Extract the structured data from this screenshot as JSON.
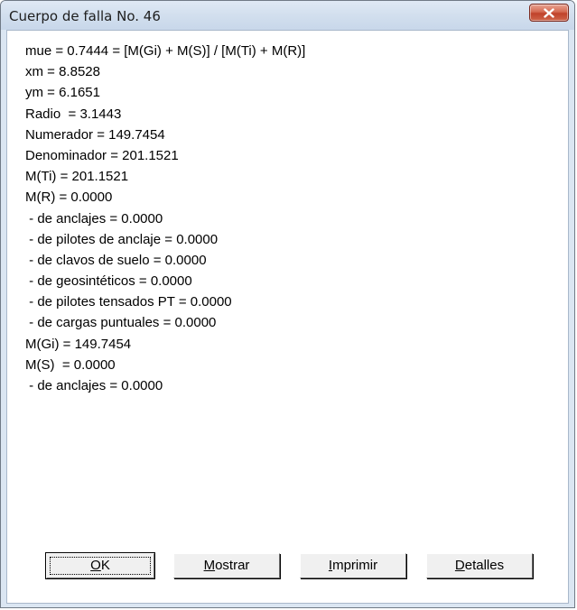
{
  "window": {
    "title": "Cuerpo de falla No. 46"
  },
  "results": {
    "lines": [
      "mue = 0.7444 = [M(Gi) + M(S)] / [M(Ti) + M(R)]",
      "xm = 8.8528",
      "ym = 6.1651",
      "Radio  = 3.1443",
      "Numerador = 149.7454",
      "Denominador = 201.1521",
      "M(Ti) = 201.1521",
      "M(R) = 0.0000",
      " - de anclajes = 0.0000",
      " - de pilotes de anclaje = 0.0000",
      " - de clavos de suelo = 0.0000",
      " - de geosintéticos = 0.0000",
      " - de pilotes tensados PT = 0.0000",
      " - de cargas puntuales = 0.0000",
      "M(Gi) = 149.7454",
      "M(S)  = 0.0000",
      " - de anclajes = 0.0000"
    ]
  },
  "buttons": {
    "ok": {
      "accel": "O",
      "rest": "K"
    },
    "mostrar": {
      "accel": "M",
      "rest": "ostrar"
    },
    "imprimir": {
      "accel": "I",
      "rest": "mprimir"
    },
    "detalles": {
      "accel": "D",
      "rest": "etalles"
    }
  },
  "icons": {
    "close": "close-icon"
  },
  "colors": {
    "title_bar": "#d2dfee",
    "close_button": "#c94a31",
    "client_background": "#ffffff",
    "button_face": "#f0f0f0"
  }
}
